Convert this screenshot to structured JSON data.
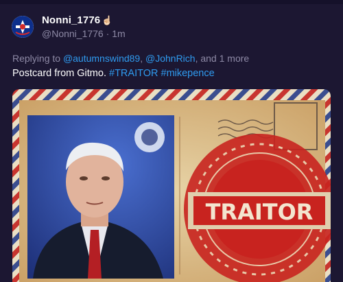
{
  "tweet": {
    "display_name": "Nonni_1776",
    "name_emoji": "☝🏻",
    "handle": "@Nonni_1776",
    "separator": "·",
    "time": "1m",
    "reply_prefix": "Replying to",
    "reply_users": [
      "@autumnswind89",
      "@JohnRich"
    ],
    "reply_comma": ",",
    "reply_suffix": ", and 1 more",
    "text_plain": "Postcard from Gitmo.",
    "hashtags": [
      "#TRAITOR",
      "#mikepence"
    ]
  },
  "media": {
    "stamp_text": "TRAITOR"
  },
  "colors": {
    "background": "#1c1732",
    "link": "#2f9bf0",
    "muted": "#8e8aa6",
    "stamp_red": "#c8231f"
  }
}
